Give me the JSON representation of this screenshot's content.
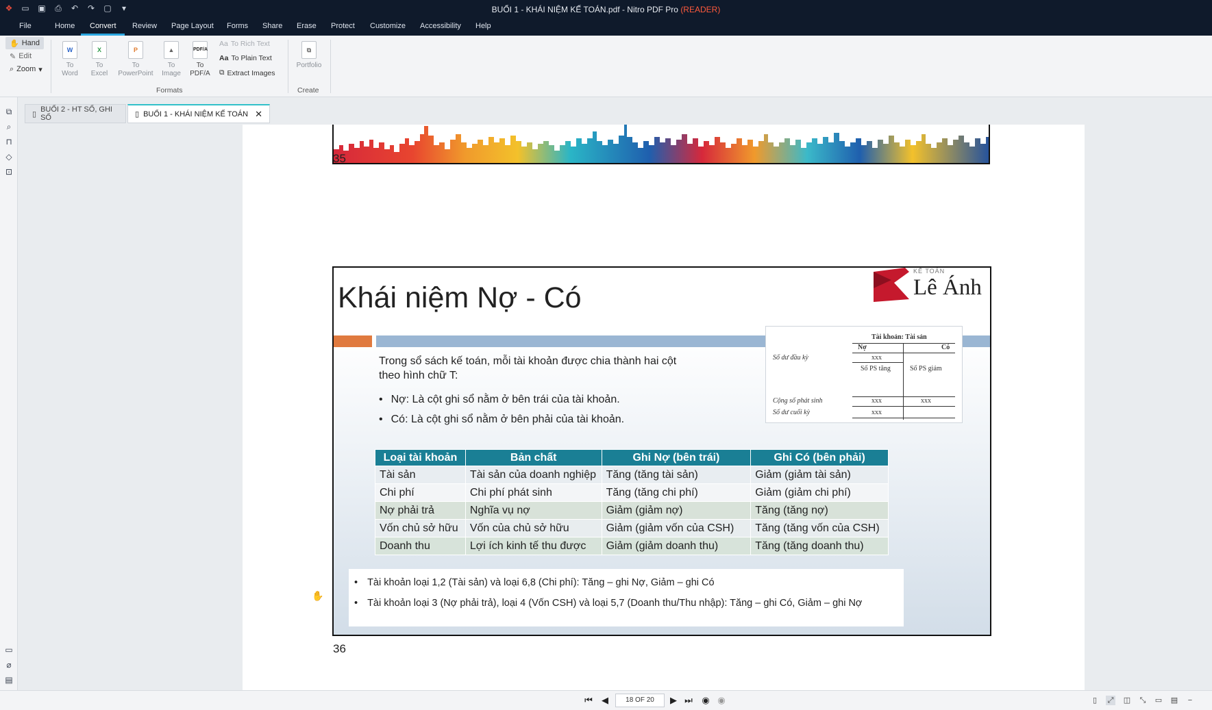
{
  "window": {
    "title": "BUỔI 1 - KHÁI NIỆM KẾ TOÁN.pdf - Nitro PDF Pro",
    "mode_tag": "(READER)",
    "colors": {
      "title_bg": "#0f1a2b",
      "accent": "#2ba7e0",
      "reader_tag": "#ff5a3c"
    }
  },
  "menu": {
    "tabs": [
      "File",
      "Home",
      "Convert",
      "Review",
      "Page Layout",
      "Forms",
      "Share",
      "Erase",
      "Protect",
      "Customize",
      "Accessibility",
      "Help"
    ],
    "active": "Convert"
  },
  "ribbon": {
    "modes": [
      "Hand",
      "Edit",
      "Zoom"
    ],
    "formats": {
      "to_word": "To\nWord",
      "to_excel": "To\nExcel",
      "to_powerpoint": "To\nPowerPoint",
      "to_image": "To\nImage",
      "to_pdfa": "To\nPDF/A",
      "to_rich_text": "To Rich Text",
      "to_plain_text": "To Plain Text",
      "extract_images": "Extract Images",
      "group_label": "Formats"
    },
    "create": {
      "portfolio": "Portfolio",
      "group_label": "Create"
    }
  },
  "doc_tabs": [
    {
      "label": "BUỔI 2 - HT SỔ, GHI SỔ"
    },
    {
      "label": "BUỔI 1 - KHÁI NIỆM KẾ TOÁN"
    }
  ],
  "pages": {
    "prev_number": "35",
    "current_number": "36"
  },
  "slide": {
    "title": "Khái niệm Nợ - Có",
    "brand": {
      "small": "KẾ TOÁN",
      "name": "Lê Ánh"
    },
    "intro": "Trong sổ sách kế toán, mỗi tài khoản được chia thành hai cột theo hình chữ T:",
    "bullets": [
      "Nợ: Là cột ghi sổ nằm ở bên trái của tài khoản.",
      "Có: Là cột ghi sổ nằm ở bên phải của tài khoản."
    ],
    "t_account": {
      "header": "Tài khoản: Tài sản",
      "debit": "Nợ",
      "credit": "Có",
      "opening": "Số dư đầu kỳ",
      "xxx": "xxx",
      "inc": "Số PS tăng",
      "dec": "Số PS giảm",
      "total": "Cộng số phát sinh",
      "closing": "Số dư cuối kỳ"
    },
    "table": {
      "headers": [
        "Loại tài khoản",
        "Bản chất",
        "Ghi Nợ (bên trái)",
        "Ghi Có (bên phải)"
      ],
      "rows": [
        [
          "Tài sản",
          "Tài sản của doanh nghiệp",
          "Tăng (tăng tài sản)",
          "Giảm (giảm tài sản)"
        ],
        [
          "Chi phí",
          "Chi phí phát sinh",
          "Tăng (tăng chi phí)",
          "Giảm (giảm chi phí)"
        ],
        [
          "Nợ phải trả",
          "Nghĩa vụ nợ",
          "Giảm (giảm nợ)",
          "Tăng (tăng nợ)"
        ],
        [
          "Vốn chủ sở hữu",
          "Vốn của chủ sở hữu",
          "Giảm (giảm vốn của CSH)",
          "Tăng (tăng vốn của CSH)"
        ],
        [
          "Doanh thu",
          "Lợi ích kinh tế thu được",
          "Giảm (giảm doanh thu)",
          "Tăng (tăng doanh thu)"
        ]
      ]
    },
    "notes": [
      "Tài khoản loại 1,2 (Tài sản) và loại 6,8 (Chi phí): Tăng – ghi Nợ, Giảm – ghi Có",
      "Tài khoản loại 3 (Nợ phải trả), loại 4 (Vốn CSH) và loại 5,7 (Doanh thu/Thu nhập): Tăng – ghi Có, Giảm – ghi Nợ"
    ]
  },
  "statusbar": {
    "page_indicator": "18 OF 20"
  }
}
